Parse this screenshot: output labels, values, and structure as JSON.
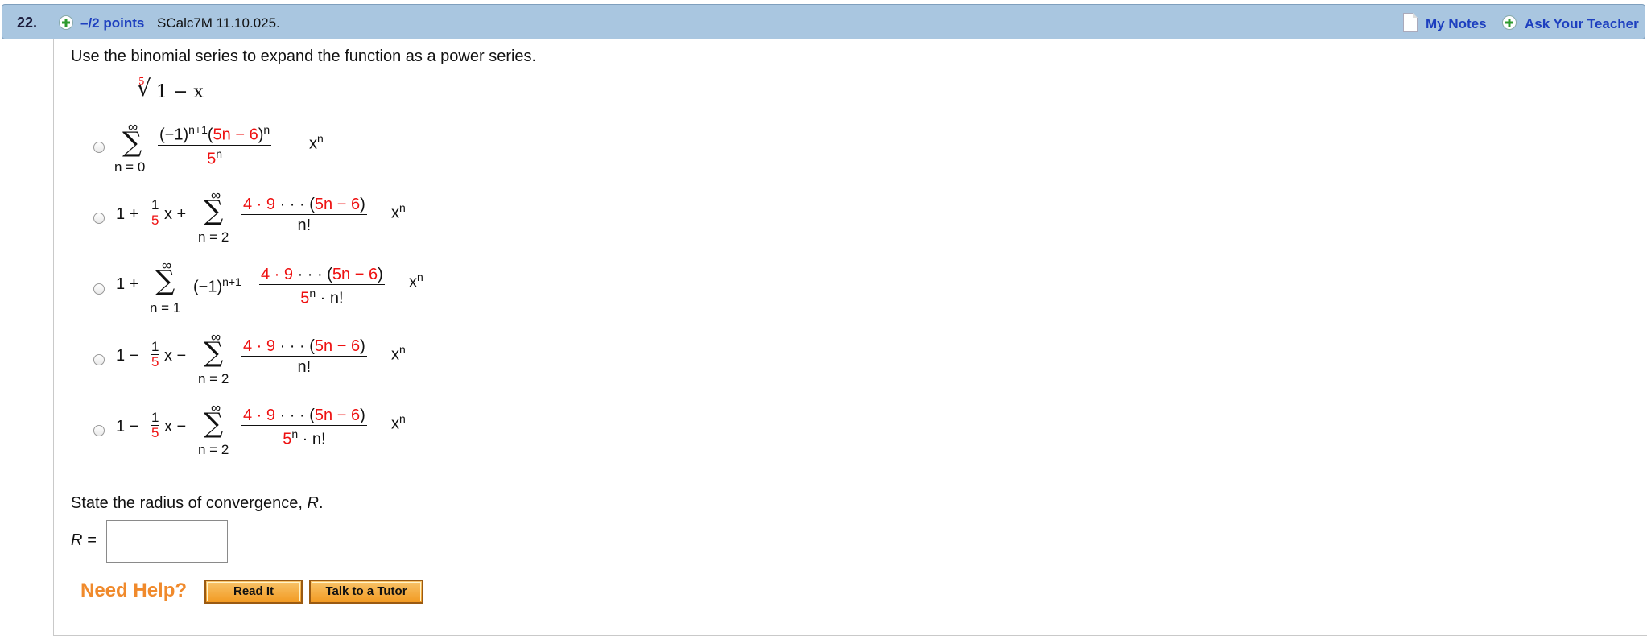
{
  "header": {
    "question_number": "22.",
    "points": "–/2 points",
    "problem_code": "SCalc7M 11.10.025.",
    "my_notes_label": "My Notes",
    "ask_teacher_label": "Ask Your Teacher"
  },
  "question": {
    "instruction": "Use the binomial series to expand the function as a power series.",
    "function": {
      "root_index": "5",
      "radicand": "1 − x"
    },
    "options": [
      {
        "sum_top": "∞",
        "sum_bottom": "n = 0",
        "num_prefix": "(−1)",
        "num_exp": "n+1",
        "num_open": "(",
        "num_red": "5n − 6",
        "num_close": ")",
        "num_exp2": "n",
        "den": "5",
        "den_exp": "n",
        "tail": "x",
        "tail_exp": "n"
      },
      {
        "lead": "1 + ",
        "frac_num": "1",
        "frac_den": "5",
        "after_frac": "x + ",
        "sum_top": "∞",
        "sum_bottom": "n = 2",
        "num_red1": "4 · 9",
        "num_dots": " · · · ",
        "num_open": "(",
        "num_red2": "5n − 6",
        "num_close": ")",
        "den": "n!",
        "tail": "x",
        "tail_exp": "n"
      },
      {
        "lead": "1 + ",
        "sum_top": "∞",
        "sum_bottom": "n = 1",
        "pre": "(−1)",
        "pre_exp": "n+1",
        "num_red1": "4 · 9",
        "num_dots": " · · · ",
        "num_open": "(",
        "num_red2": "5n − 6",
        "num_close": ")",
        "den": "5",
        "den_exp": "n",
        "den_tail": " · n!",
        "tail": "x",
        "tail_exp": "n"
      },
      {
        "lead": "1 − ",
        "frac_num": "1",
        "frac_den": "5",
        "after_frac": "x − ",
        "sum_top": "∞",
        "sum_bottom": "n = 2",
        "num_red1": "4 · 9",
        "num_dots": " · · · ",
        "num_open": "(",
        "num_red2": "5n − 6",
        "num_close": ")",
        "den": "n!",
        "tail": "x",
        "tail_exp": "n"
      },
      {
        "lead": "1 − ",
        "frac_num": "1",
        "frac_den": "5",
        "after_frac": "x − ",
        "sum_top": "∞",
        "sum_bottom": "n = 2",
        "num_red1": "4 · 9",
        "num_dots": " · · · ",
        "num_open": "(",
        "num_red2": "5n − 6",
        "num_close": ")",
        "den": "5",
        "den_exp": "n",
        "den_tail": " · n!",
        "tail": "x",
        "tail_exp": "n"
      }
    ],
    "radius_prompt": "State the radius of convergence, ",
    "radius_var": "R",
    "radius_period": ".",
    "radius_label": "R =",
    "radius_value": ""
  },
  "help": {
    "need_help": "Need Help?",
    "read_it": "Read It",
    "talk_tutor": "Talk to a Tutor"
  },
  "colors": {
    "header_bg": "#a9c6e0",
    "link": "#1d3fbf",
    "math_red": "#e11111",
    "help_orange": "#f08a2c"
  },
  "icons": [
    "plus-icon",
    "notes-icon",
    "plus-icon"
  ]
}
